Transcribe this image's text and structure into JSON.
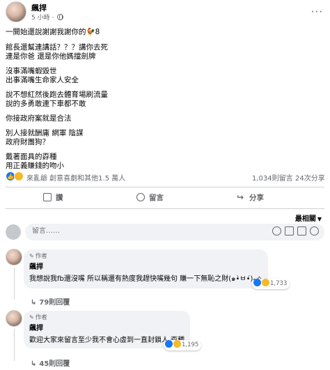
{
  "post": {
    "author": "飆捍",
    "time": "5 小時 ·",
    "more": "···",
    "lines": [
      "一開始還說謝謝我謝你的🐓8",
      "館長還幫連講話？？？講你去死",
      " 連是你爸 還是你他媽擋劍牌",
      "沒事滿嘴蝦毀世",
      "出事滿嘴生命家人安全",
      "說不想紅然後跑去體育場刷流量",
      "說的多勇敢連下車都不敢",
      "你接政府案就是合法",
      "別人接就酬庸 網軍 陰謀",
      "政府財團狗？",
      "戴著面具的孬種",
      "用正義賺錢的吻小"
    ]
  },
  "stats": {
    "reactors": "來亂爺 創意喜劇和其他1.5 萬人",
    "comments": "1,034則留言",
    "shares": "24次分享"
  },
  "actions": {
    "like": "讚",
    "comment": "留言",
    "share": "分享"
  },
  "sort": {
    "label": "最相關"
  },
  "composer": {
    "placeholder": "留言……"
  },
  "comments": [
    {
      "badge": "作者",
      "name": "飆捍",
      "text": "我想說我fb還沒嘴 所以稱還有熱度我趕快嘴幾句 賺一下無恥之財(๑•̀ㅂ•́)و✧",
      "reactions": "1,733",
      "replies": "79則回覆"
    },
    {
      "badge": "作者",
      "name": "飆捍",
      "text": "歡迎大家來留言至少我不會心虛到一直封鎖人 孬種",
      "reactions": "1,195",
      "replies": "45則回覆"
    }
  ],
  "colors": {
    "like": "#1877f2",
    "haha": "#f7b928",
    "secondary_text": "#65676b",
    "bubble": "#f0f2f5"
  }
}
